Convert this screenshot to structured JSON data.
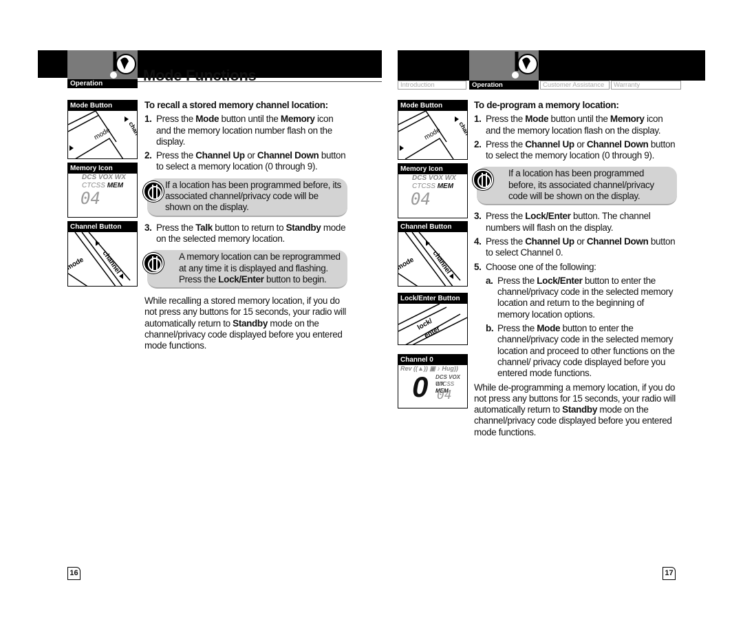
{
  "left_page": {
    "section_tab": "Operation",
    "title": "Mode Functions",
    "figures": [
      "Mode Button",
      "Memory Icon",
      "Channel Button"
    ],
    "heading": "To recall a stored memory channel location:",
    "steps": [
      {
        "num": "1.",
        "parts": [
          "Press the ",
          "Mode",
          " button until the ",
          "Memory",
          " icon and the memory location number flash on the display."
        ]
      },
      {
        "num": "2.",
        "parts": [
          "Press the ",
          "Channel Up",
          " or ",
          "Channel Down",
          " button to select a memory location (0 through 9)."
        ]
      },
      {
        "num": "3.",
        "parts": [
          "Press the ",
          "Talk",
          " button to return to ",
          "Standby",
          " mode on the selected memory location."
        ]
      }
    ],
    "note1": "If a location has been programmed before, its associated channel/privacy code will be shown on the display.",
    "note2": {
      "parts": [
        "A memory location can be reprogrammed at any time it is displayed and flashing. Press the ",
        "Lock/Enter",
        " button to begin."
      ]
    },
    "closing": {
      "parts": [
        "While recalling a stored memory location, if you do not press any buttons for 15 seconds, your radio will automatically return to ",
        "Standby",
        " mode on the channel/privacy code displayed before you entered mode functions."
      ]
    },
    "page_number": "16"
  },
  "right_page": {
    "nav_tabs": [
      "Introduction",
      "Operation",
      "Customer Assistance",
      "Warranty"
    ],
    "active_tab": "Operation",
    "figures": [
      "Mode Button",
      "Memory Icon",
      "Channel Button",
      "Lock/Enter Button",
      "Channel 0"
    ],
    "heading": "To de-program a memory location:",
    "steps": [
      {
        "num": "1.",
        "parts": [
          "Press the ",
          "Mode",
          " button until the ",
          "Memory",
          " icon and the memory location flash on the display."
        ]
      },
      {
        "num": "2.",
        "parts": [
          "Press the ",
          "Channel Up",
          " or ",
          "Channel Down",
          " button to select the memory location (0 through 9)."
        ]
      },
      {
        "num": "3.",
        "parts": [
          "Press the ",
          "Lock/Enter",
          " button. The channel numbers will flash on the display.",
          "",
          ""
        ]
      },
      {
        "num": "4.",
        "parts": [
          "Press the ",
          "Channel Up",
          " or ",
          "Channel Down",
          " button to select Channel 0."
        ]
      },
      {
        "num": "5.",
        "parts": [
          "Choose one of the following:",
          "",
          "",
          "",
          ""
        ]
      }
    ],
    "note1": "If a location has been programmed before, its associated channel/privacy code will be shown on the display.",
    "options": [
      {
        "num": "a.",
        "parts": [
          "Press the ",
          "Lock/Enter",
          " button to enter the channel/privacy code in the selected memory location and return to the beginning of memory location options."
        ]
      },
      {
        "num": "b.",
        "parts": [
          "Press the ",
          "Mode",
          " button to enter the channel/privacy code in the selected memory location and proceed to other functions on the channel/ privacy code displayed before you entered mode functions."
        ]
      }
    ],
    "closing": {
      "parts": [
        "While de-programming a memory location, if you do not press any buttons for 15 seconds, your radio will automatically return to ",
        "Standby",
        " mode on the channel/privacy code displayed before you entered mode functions."
      ]
    },
    "page_number": "17"
  },
  "lcd": {
    "top": "DCS VOX WX",
    "ctcss": "CTCSS",
    "mem": "MEM",
    "digits": "04",
    "ch0_top": "Rev ((▲)) ▣ ♪ Hug))",
    "ch0_digit": "0"
  }
}
